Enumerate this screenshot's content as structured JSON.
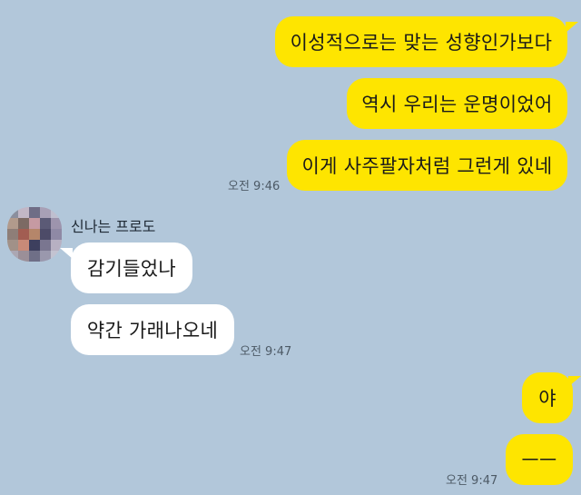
{
  "chat": {
    "sender_name": "신나는 프로도",
    "messages": [
      {
        "from": "me",
        "text": "이성적으로는 맞는 성향인가보다"
      },
      {
        "from": "me",
        "text": "역시 우리는 운명이었어"
      },
      {
        "from": "me",
        "text": "이게 사주팔자처럼 그런게 있네"
      },
      {
        "from": "them",
        "text": "감기들었나"
      },
      {
        "from": "them",
        "text": "약간 가래나오네"
      },
      {
        "from": "me",
        "text": "야"
      },
      {
        "from": "me",
        "text": "ㅡㅡ"
      }
    ],
    "timestamps": [
      "오전 9:46",
      "오전 9:47",
      "오전 9:47"
    ]
  },
  "colors": {
    "background": "#b2c7da",
    "my_bubble": "#fee500",
    "their_bubble": "#ffffff"
  },
  "icons": {
    "avatar": "pixelated-profile-avatar"
  }
}
